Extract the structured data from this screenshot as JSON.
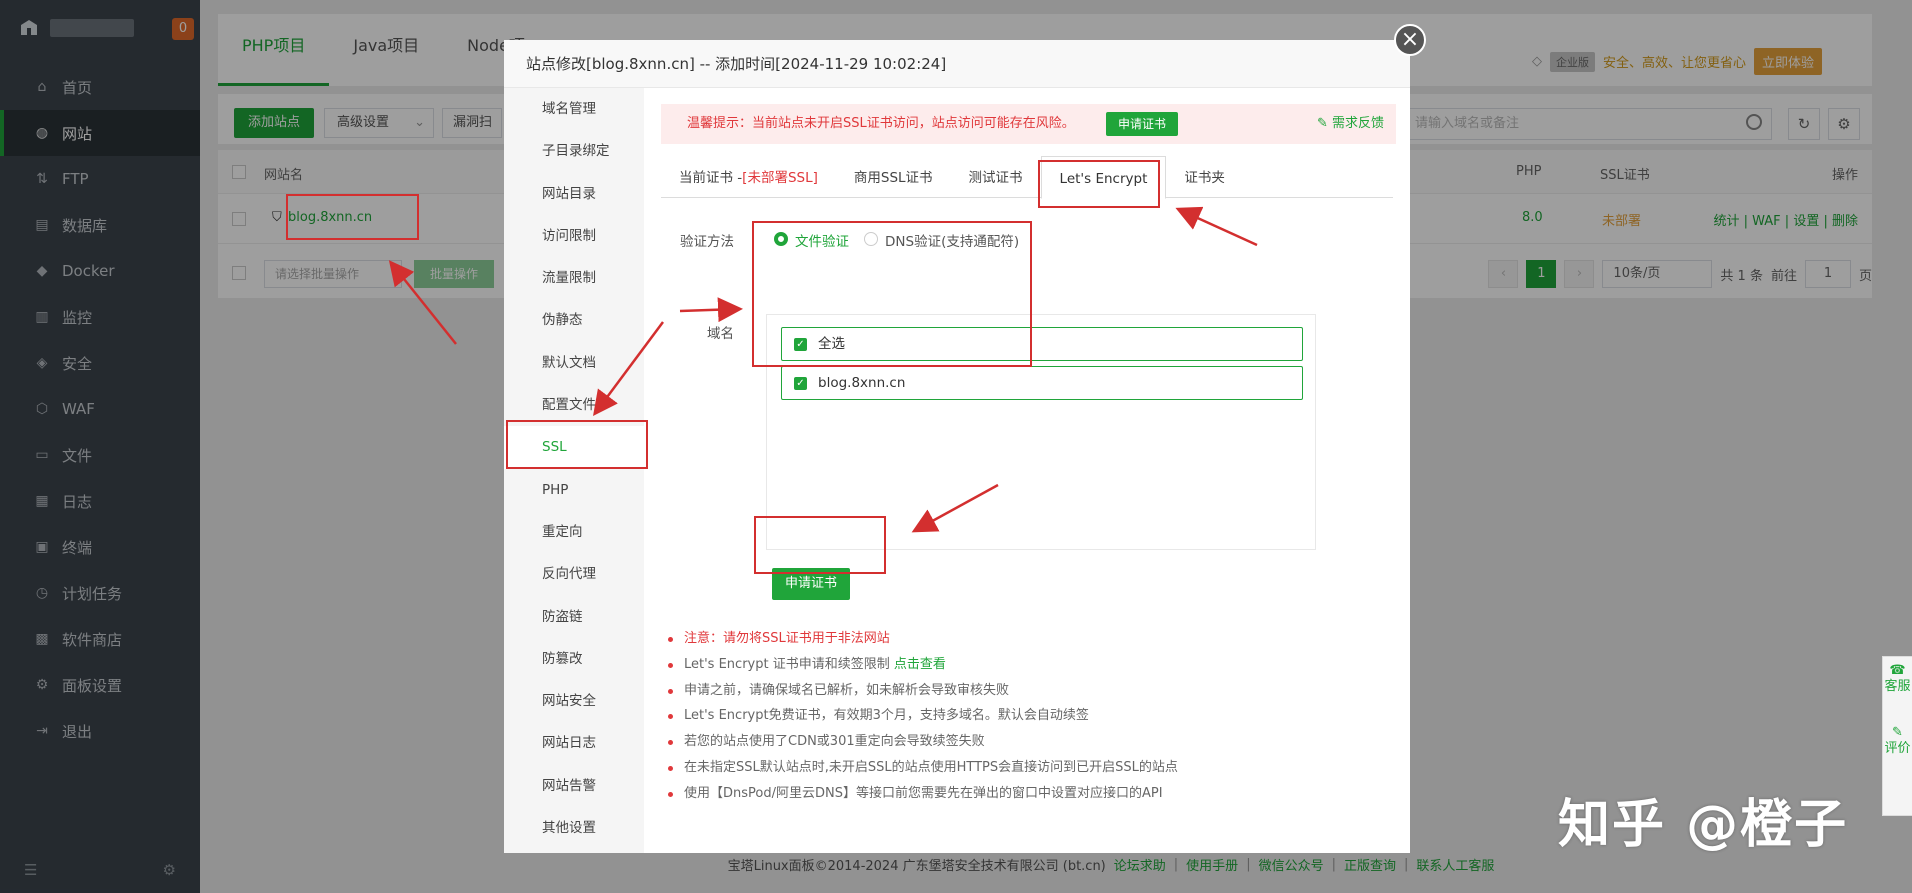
{
  "sidebar": {
    "badge": "0",
    "items": [
      {
        "label": "首页",
        "icon": "home-icon",
        "glyph": "⌂"
      },
      {
        "label": "网站",
        "icon": "globe-icon",
        "glyph": "◍"
      },
      {
        "label": "FTP",
        "icon": "ftp-icon",
        "glyph": "⇅"
      },
      {
        "label": "数据库",
        "icon": "database-icon",
        "glyph": "▤"
      },
      {
        "label": "Docker",
        "icon": "docker-icon",
        "glyph": "◆"
      },
      {
        "label": "监控",
        "icon": "monitor-icon",
        "glyph": "▥"
      },
      {
        "label": "安全",
        "icon": "shield-icon",
        "glyph": "◈"
      },
      {
        "label": "WAF",
        "icon": "waf-icon",
        "glyph": "⬡"
      },
      {
        "label": "文件",
        "icon": "folder-icon",
        "glyph": "▭"
      },
      {
        "label": "日志",
        "icon": "log-icon",
        "glyph": "▦"
      },
      {
        "label": "终端",
        "icon": "terminal-icon",
        "glyph": "▣"
      },
      {
        "label": "计划任务",
        "icon": "clock-icon",
        "glyph": "◷"
      },
      {
        "label": "软件商店",
        "icon": "store-icon",
        "glyph": "▩"
      },
      {
        "label": "面板设置",
        "icon": "gear-icon",
        "glyph": "⚙"
      },
      {
        "label": "退出",
        "icon": "logout-icon",
        "glyph": "⇥"
      }
    ]
  },
  "main": {
    "tabs": [
      "PHP项目",
      "Java项目",
      "Node项"
    ],
    "enterprise": "企业版",
    "enterprise_tip": "安全、高效、让您更省心",
    "trial": "立即体验",
    "add_site": "添加站点",
    "advanced": "高级设置",
    "filter": "漏洞扫",
    "search_placeholder": "请输入域名或备注",
    "table": {
      "col_site": "网站名",
      "col_php": "PHP",
      "col_ssl": "SSL证书",
      "col_ops": "操作",
      "row": {
        "site": "blog.8xnn.cn",
        "php": "8.0",
        "ssl": "未部署",
        "ops": [
          "统计",
          "WAF",
          "设置",
          "删除"
        ]
      }
    },
    "batch_placeholder": "请选择批量操作",
    "batch_btn": "批量操作",
    "pager": {
      "current": "1",
      "size": "10条/页",
      "total": "共 1 条",
      "goto": "前往",
      "page_input": "1",
      "unit": "页"
    }
  },
  "footer": {
    "copyright": "宝塔Linux面板©2014-2024 广东堡塔安全技术有限公司 (bt.cn)",
    "links": [
      "论坛求助",
      "使用手册",
      "微信公众号",
      "正版查询",
      "联系人工客服"
    ]
  },
  "modal": {
    "title": "站点修改[blog.8xnn.cn] -- 添加时间[2024-11-29 10:02:24]",
    "nav": [
      "域名管理",
      "子目录绑定",
      "网站目录",
      "访问限制",
      "流量限制",
      "伪静态",
      "默认文档",
      "配置文件",
      "SSL",
      "PHP",
      "重定向",
      "反向代理",
      "防盗链",
      "防篡改",
      "网站安全",
      "网站日志",
      "网站告警",
      "其他设置"
    ],
    "warning": "温馨提示：当前站点未开启SSL证书访问，站点访问可能存在风险。",
    "warning_btn": "申请证书",
    "feedback": "需求反馈",
    "ssl_tabs": {
      "current_prefix": "当前证书 -",
      "current_status": "[未部署SSL]",
      "commercial": "商用SSL证书",
      "test": "测试证书",
      "letsencrypt": "Let's Encrypt",
      "folder": "证书夹"
    },
    "verify_label": "验证方法",
    "verify_file": "文件验证",
    "verify_dns": "DNS验证(支持通配符)",
    "domain_label": "域名",
    "select_all": "全选",
    "domain": "blog.8xnn.cn",
    "apply_btn": "申请证书",
    "notes": [
      "注意：请勿将SSL证书用于非法网站",
      "Let's Encrypt 证书申请和续签限制",
      "申请之前，请确保域名已解析，如未解析会导致审核失败",
      "Let's Encrypt免费证书，有效期3个月，支持多域名。默认会自动续签",
      "若您的站点使用了CDN或301重定向会导致续签失败",
      "在未指定SSL默认站点时,未开启SSL的站点使用HTTPS会直接访问到已开启SSL的站点",
      "使用【DnsPod/阿里云DNS】等接口前您需要先在弹出的窗口中设置对应接口的API"
    ],
    "note_link": "点击查看"
  },
  "side_float": {
    "service": "客服",
    "review": "评价"
  },
  "watermark": "知乎 @橙子",
  "colors": {
    "accent": "#20a53a",
    "danger": "#e0383b",
    "annotation": "#d32f2f",
    "sidebar": "#3c444d"
  }
}
